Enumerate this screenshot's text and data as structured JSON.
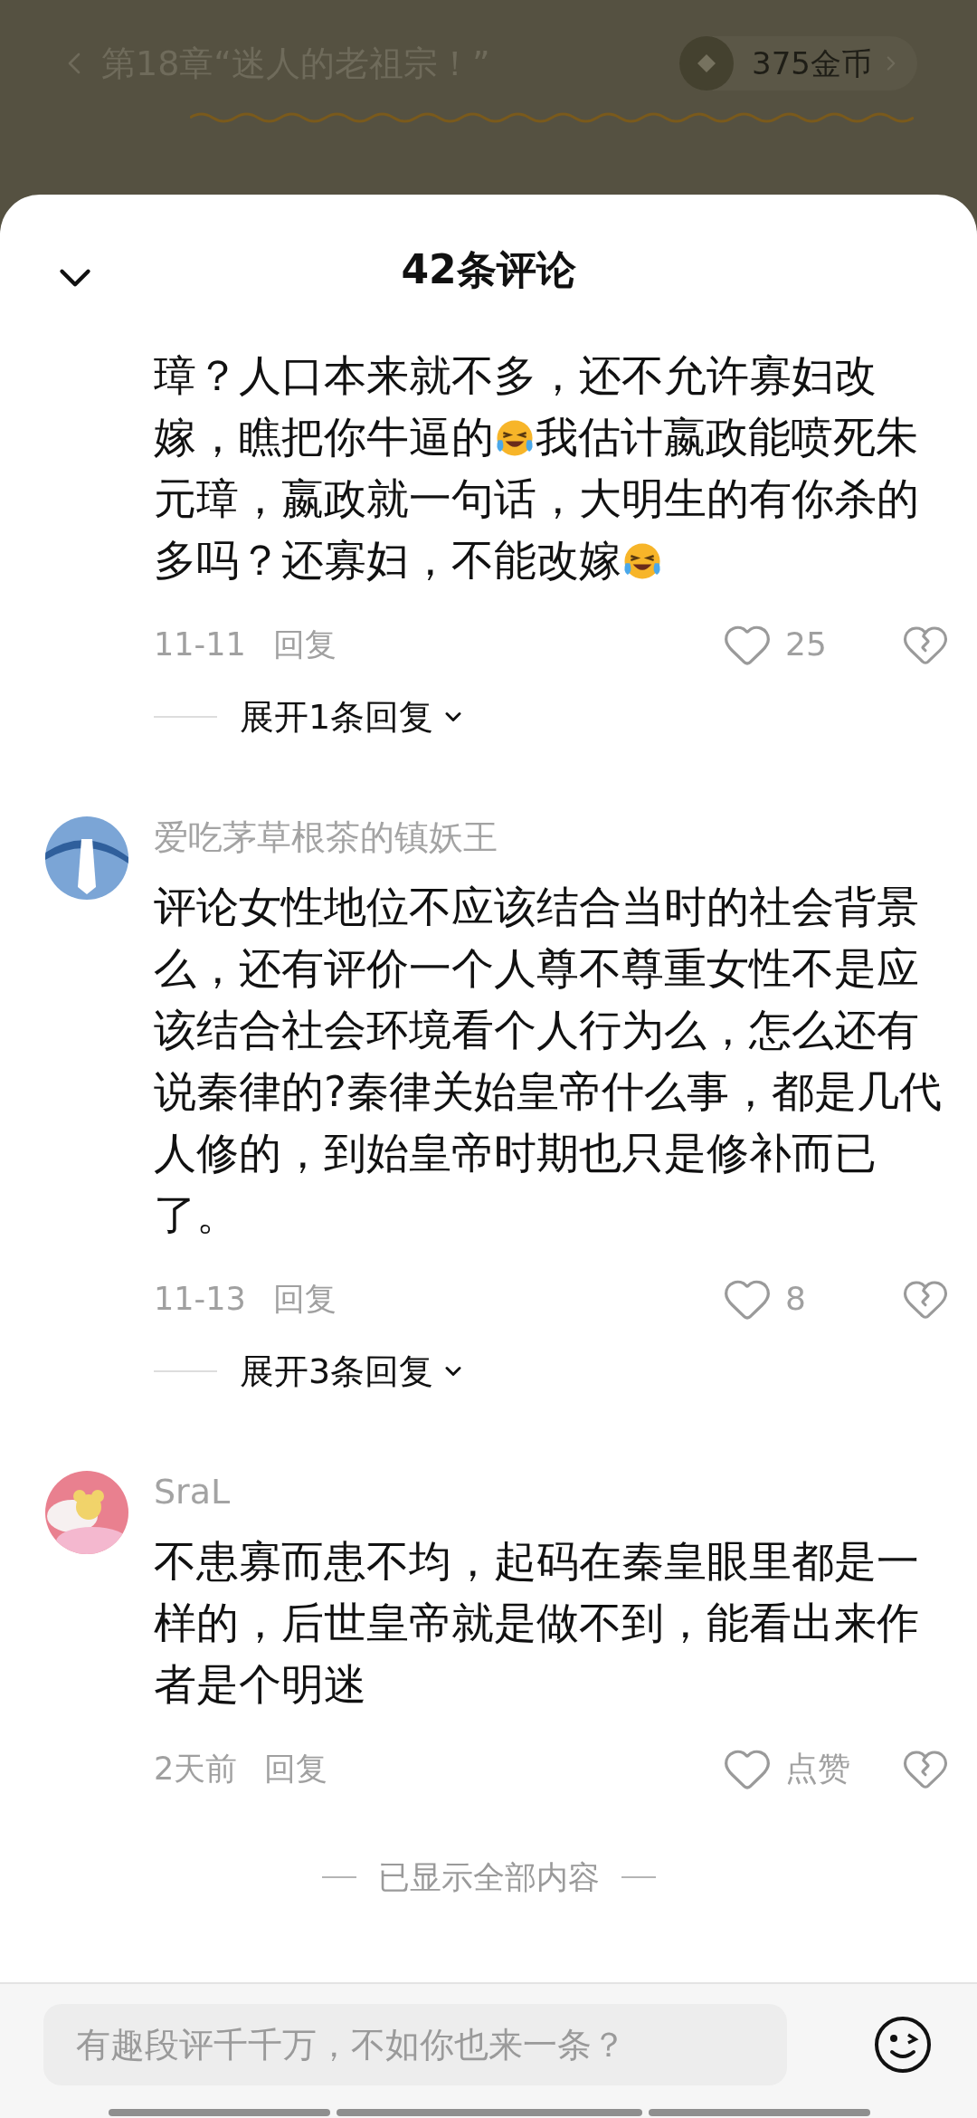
{
  "reader_header": {
    "chapter_title": "第18章“迷人的老祖宗！”",
    "coins": "375金币"
  },
  "comments_sheet": {
    "title": "42条评论",
    "comments": [
      {
        "kind": "continued",
        "segments": [
          {
            "kind": "text",
            "text": "璋？人口本来就不多，还不允许寡妇改嫁，瞧把你牛逼的"
          },
          {
            "kind": "emoji"
          },
          {
            "kind": "text",
            "text": "我估计嬴政能喷死朱元璋，嬴政就一句话，大明生的有你杀的多吗？还寡妇，不能改嫁"
          },
          {
            "kind": "emoji"
          }
        ],
        "time": "11-11",
        "reply": "回复",
        "likes": "25",
        "expand": "展开1条回复"
      },
      {
        "kind": "full",
        "author": "爱吃茅草根茶的镇妖王",
        "segments": [
          {
            "kind": "text",
            "text": "评论女性地位不应该结合当时的社会背景么，还有评价一个人尊不尊重女性不是应该结合社会环境看个人行为么，怎么还有说秦律的?秦律关始皇帝什么事，都是几代人修的，到始皇帝时期也只是修补而已了。"
          }
        ],
        "time": "11-13",
        "reply": "回复",
        "likes": "8",
        "expand": "展开3条回复"
      },
      {
        "kind": "full",
        "author": "SraL",
        "segments": [
          {
            "kind": "text",
            "text": "不患寡而患不均，起码在秦皇眼里都是一样的，后世皇帝就是做不到，能看出来作者是个明迷"
          }
        ],
        "time": "2天前",
        "reply": "回复",
        "likes": "点赞"
      }
    ],
    "end_note": "已显示全部内容",
    "input": {
      "placeholder": "有趣段评千千万，不如你也来一条？"
    }
  }
}
